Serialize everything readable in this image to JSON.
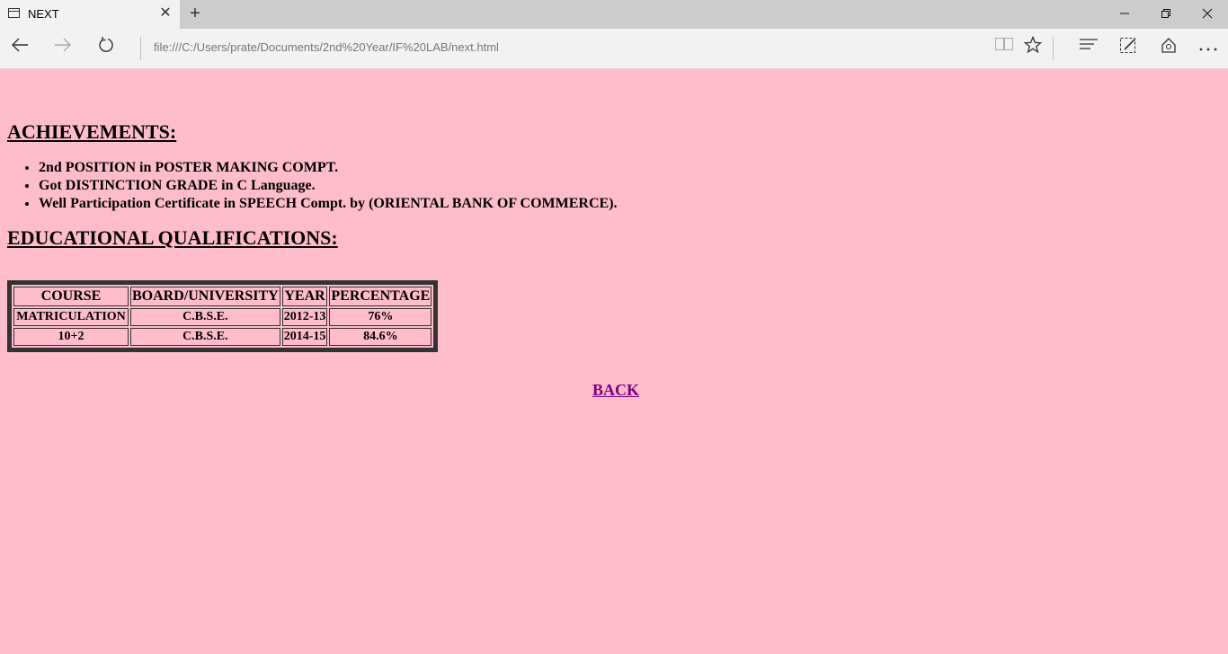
{
  "browser": {
    "tab_title": "NEXT",
    "address": "file:///C:/Users/prate/Documents/2nd%20Year/IF%20LAB/next.html",
    "icons": [
      "tab-page-icon",
      "close-icon",
      "plus-icon",
      "minimize-icon",
      "restore-icon",
      "window-close-icon",
      "back-arrow-icon",
      "forward-arrow-icon",
      "refresh-icon",
      "reading-view-icon",
      "star-icon",
      "hub-icon",
      "web-note-icon",
      "share-icon",
      "more-icon"
    ]
  },
  "page": {
    "background": "#ffbccb",
    "achievements_heading": "ACHIEVEMENTS:",
    "achievements": [
      "2nd POSITION in POSTER MAKING COMPT.",
      "Got DISTINCTION GRADE in C Language.",
      "Well Participation Certificate in SPEECH Compt. by (ORIENTAL BANK OF COMMERCE)."
    ],
    "education_heading": "EDUCATIONAL QUALIFICATIONS:",
    "table": {
      "headers": [
        "COURSE",
        "BOARD/UNIVERSITY",
        "YEAR",
        "PERCENTAGE"
      ],
      "rows": [
        [
          "MATRICULATION",
          "C.B.S.E.",
          "2012-13",
          "76%"
        ],
        [
          "10+2",
          "C.B.S.E.",
          "2014-15",
          "84.6%"
        ]
      ]
    },
    "back_link": "BACK",
    "link_color": "#800080"
  }
}
